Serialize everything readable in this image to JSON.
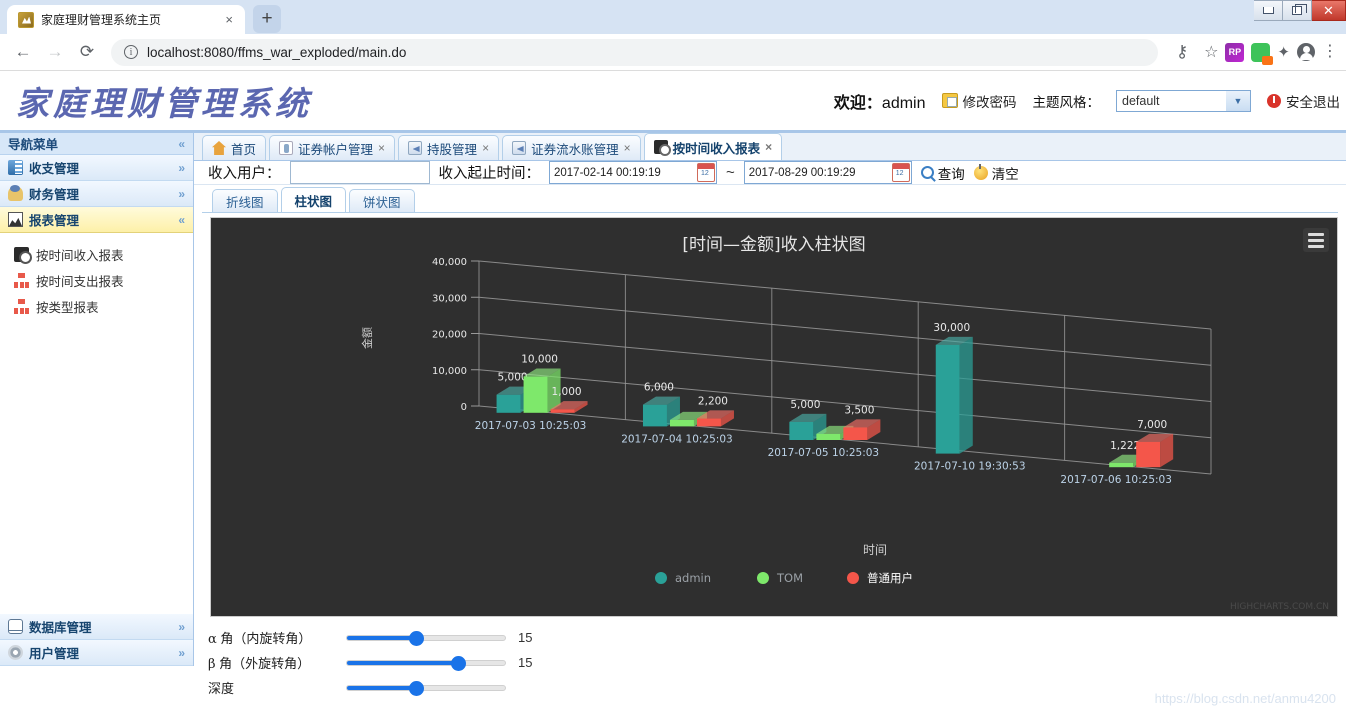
{
  "browser": {
    "tab_title": "家庭理财管理系统主页",
    "tab_close": "×",
    "new_tab": "+",
    "back_icon": "←",
    "forward_icon": "→",
    "reload_icon": "⟳",
    "info_icon": "i",
    "url": "localhost:8080/ffms_war_exploded/main.do",
    "star_icon": "☆",
    "ext_rp": "RP",
    "puzzle_icon": "✦",
    "menu_dots": "⋮",
    "win_min": "",
    "win_restore": "",
    "win_close": "✕"
  },
  "header": {
    "logo": "家庭理财管理系统",
    "welcome_prefix": "欢迎：",
    "username": "admin",
    "change_password": "修改密码",
    "theme_label": "主题风格：",
    "theme_value": "default",
    "theme_arrow": "▼",
    "logout": "安全退出"
  },
  "sidebar": {
    "title": "导航菜单",
    "collapse_icon": "«",
    "expand_icon": "»",
    "groups": [
      {
        "label": "收支管理",
        "icon": "income-icon",
        "state": "collapsed",
        "chev": "»"
      },
      {
        "label": "财务管理",
        "icon": "finance-icon",
        "state": "collapsed",
        "chev": "»"
      },
      {
        "label": "报表管理",
        "icon": "report-icon",
        "state": "expanded",
        "chev": "«"
      }
    ],
    "sub_items": [
      {
        "label": "按时间收入报表",
        "icon": "income-report-icon"
      },
      {
        "label": "按时间支出报表",
        "icon": "tree-icon"
      },
      {
        "label": "按类型报表",
        "icon": "tree-icon"
      }
    ],
    "bottom_groups": [
      {
        "label": "数据库管理",
        "icon": "database-icon",
        "chev": "»"
      },
      {
        "label": "用户管理",
        "icon": "user-gear-icon",
        "chev": "»"
      }
    ]
  },
  "tabs": [
    {
      "label": "首页",
      "icon": "home-icon",
      "closable": false,
      "active": false
    },
    {
      "label": "证券帐户管理",
      "icon": "security-account-icon",
      "closable": true,
      "active": false,
      "close": "×"
    },
    {
      "label": "持股管理",
      "icon": "box-icon",
      "closable": true,
      "active": false,
      "close": "×"
    },
    {
      "label": "证券流水账管理",
      "icon": "box-icon",
      "closable": true,
      "active": false,
      "close": "×"
    },
    {
      "label": "按时间收入报表",
      "icon": "report-icon",
      "closable": true,
      "active": true,
      "close": "×"
    }
  ],
  "toolbar": {
    "user_label": "收入用户：",
    "user_value": "",
    "time_label": "收入起止时间：",
    "date_start": "2017-02-14 00:19:19",
    "date_end": "2017-08-29 00:19:29",
    "range_sep": "~",
    "search_button": "查询",
    "clear_button": "清空"
  },
  "chart_tabs": [
    {
      "label": "折线图",
      "active": false
    },
    {
      "label": "柱状图",
      "active": true
    },
    {
      "label": "饼状图",
      "active": false
    }
  ],
  "chart_data": {
    "type": "bar",
    "title": "[时间—金额]收入柱状图",
    "xlabel": "时间",
    "ylabel": "金额",
    "ylim": [
      0,
      40000
    ],
    "yticks": [
      "0",
      "10,000",
      "20,000",
      "30,000",
      "40,000"
    ],
    "ytick_values": [
      0,
      10000,
      20000,
      30000,
      40000
    ],
    "grid": true,
    "three_d": true,
    "legend_position": "bottom",
    "background": "#2f2f2f",
    "categories": [
      "2017-07-03 10:25:03",
      "2017-07-04 10:25:03",
      "2017-07-05 10:25:03",
      "2017-07-10 19:30:53",
      "2017-07-06 10:25:03"
    ],
    "series": [
      {
        "name": "admin",
        "color": "#2aa198",
        "values": [
          5000,
          6000,
          5000,
          30000,
          0
        ],
        "labels": [
          "5,000",
          "6,000",
          "5,000",
          "30,000",
          ""
        ]
      },
      {
        "name": "TOM",
        "color": "#7ee86b",
        "values": [
          10000,
          1800,
          1700,
          0,
          1222
        ],
        "labels": [
          "10,000",
          "",
          "",
          "",
          "1,222"
        ]
      },
      {
        "name": "普通用户",
        "color": "#f4564a",
        "values": [
          1000,
          2200,
          3500,
          0,
          7000
        ],
        "labels": [
          "1,000",
          "2,200",
          "3,500",
          "",
          "7,000"
        ]
      }
    ],
    "watermark": "HIGHCHARTS.COM.CN"
  },
  "sliders": [
    {
      "label_prefix": "α",
      "label_rest": " 角（内旋转角）",
      "value": "15",
      "fill_pct": 45
    },
    {
      "label_prefix": "β",
      "label_rest": " 角（外旋转角）",
      "value": "15",
      "fill_pct": 72
    },
    {
      "label_prefix": "深",
      "label_rest": "度",
      "value": "",
      "fill_pct": 45
    }
  ],
  "page_watermark": "https://blog.csdn.net/anmu4200"
}
